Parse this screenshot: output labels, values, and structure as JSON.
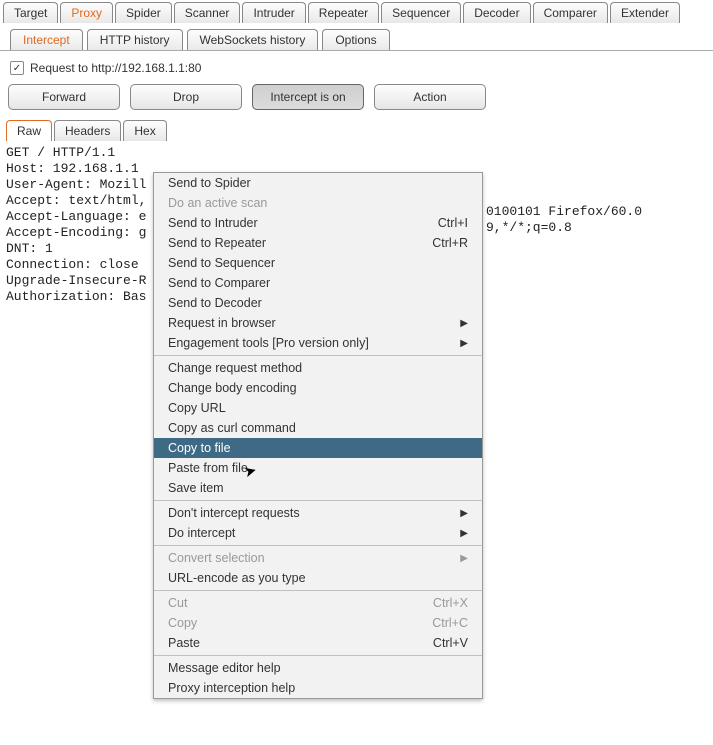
{
  "topTabs": [
    "Target",
    "Proxy",
    "Spider",
    "Scanner",
    "Intruder",
    "Repeater",
    "Sequencer",
    "Decoder",
    "Comparer",
    "Extender"
  ],
  "topActive": "Proxy",
  "subTabs": [
    "Intercept",
    "HTTP history",
    "WebSockets history",
    "Options"
  ],
  "subActive": "Intercept",
  "requestLabel": "Request to http://192.168.1.1:80",
  "buttons": {
    "forward": "Forward",
    "drop": "Drop",
    "intercept": "Intercept is on",
    "action": "Action"
  },
  "viewTabs": [
    "Raw",
    "Headers",
    "Hex"
  ],
  "viewActive": "Raw",
  "rawLines": [
    "GET / HTTP/1.1",
    "Host: 192.168.1.1",
    "User-Agent: Mozill",
    "Accept: text/html,",
    "Accept-Language: e",
    "Accept-Encoding: g",
    "DNT: 1",
    "Connection: close",
    "Upgrade-Insecure-R",
    "Authorization: Bas"
  ],
  "rawRightLines": [
    "0100101 Firefox/60.0",
    "9,*/*;q=0.8"
  ],
  "menu": [
    {
      "type": "item",
      "label": "Send to Spider"
    },
    {
      "type": "item",
      "label": "Do an active scan",
      "disabled": true
    },
    {
      "type": "item",
      "label": "Send to Intruder",
      "shortcut": "Ctrl+I"
    },
    {
      "type": "item",
      "label": "Send to Repeater",
      "shortcut": "Ctrl+R"
    },
    {
      "type": "item",
      "label": "Send to Sequencer"
    },
    {
      "type": "item",
      "label": "Send to Comparer"
    },
    {
      "type": "item",
      "label": "Send to Decoder"
    },
    {
      "type": "item",
      "label": "Request in browser",
      "submenu": true
    },
    {
      "type": "item",
      "label": "Engagement tools [Pro version only]",
      "submenu": true
    },
    {
      "type": "sep"
    },
    {
      "type": "item",
      "label": "Change request method"
    },
    {
      "type": "item",
      "label": "Change body encoding"
    },
    {
      "type": "item",
      "label": "Copy URL"
    },
    {
      "type": "item",
      "label": "Copy as curl command"
    },
    {
      "type": "item",
      "label": "Copy to file",
      "highlight": true
    },
    {
      "type": "item",
      "label": "Paste from file"
    },
    {
      "type": "item",
      "label": "Save item"
    },
    {
      "type": "sep"
    },
    {
      "type": "item",
      "label": "Don't intercept requests",
      "submenu": true
    },
    {
      "type": "item",
      "label": "Do intercept",
      "submenu": true
    },
    {
      "type": "sep"
    },
    {
      "type": "item",
      "label": "Convert selection",
      "submenu": true,
      "disabled": true
    },
    {
      "type": "item",
      "label": "URL-encode as you type"
    },
    {
      "type": "sep"
    },
    {
      "type": "item",
      "label": "Cut",
      "shortcut": "Ctrl+X",
      "disabled": true
    },
    {
      "type": "item",
      "label": "Copy",
      "shortcut": "Ctrl+C",
      "disabled": true
    },
    {
      "type": "item",
      "label": "Paste",
      "shortcut": "Ctrl+V"
    },
    {
      "type": "sep"
    },
    {
      "type": "item",
      "label": "Message editor help"
    },
    {
      "type": "item",
      "label": "Proxy interception help"
    }
  ]
}
